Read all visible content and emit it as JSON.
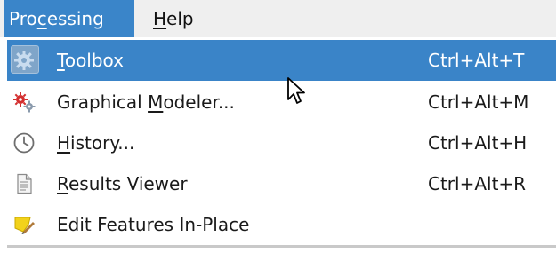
{
  "menubar": {
    "items": [
      {
        "label_pre": "Pro",
        "label_ul": "c",
        "label_post": "essing"
      },
      {
        "label_pre": "",
        "label_ul": "H",
        "label_post": "elp"
      }
    ]
  },
  "menu": {
    "items": [
      {
        "pre": "",
        "ul": "T",
        "post": "oolbox",
        "shortcut": "Ctrl+Alt+T",
        "icon": "gear-icon",
        "active": true
      },
      {
        "pre": "Graphical ",
        "ul": "M",
        "post": "odeler...",
        "shortcut": "Ctrl+Alt+M",
        "icon": "modeler-gears-icon"
      },
      {
        "pre": "",
        "ul": "H",
        "post": "istory...",
        "shortcut": "Ctrl+Alt+H",
        "icon": "clock-icon"
      },
      {
        "pre": "",
        "ul": "R",
        "post": "esults Viewer",
        "shortcut": "Ctrl+Alt+R",
        "icon": "document-icon"
      },
      {
        "pre": "Edit Features In-Place",
        "ul": "",
        "post": "",
        "shortcut": "",
        "icon": "pencil-edit-icon"
      }
    ]
  },
  "colors": {
    "highlight": "#3a84c8",
    "menubar_bg": "#efefef"
  }
}
